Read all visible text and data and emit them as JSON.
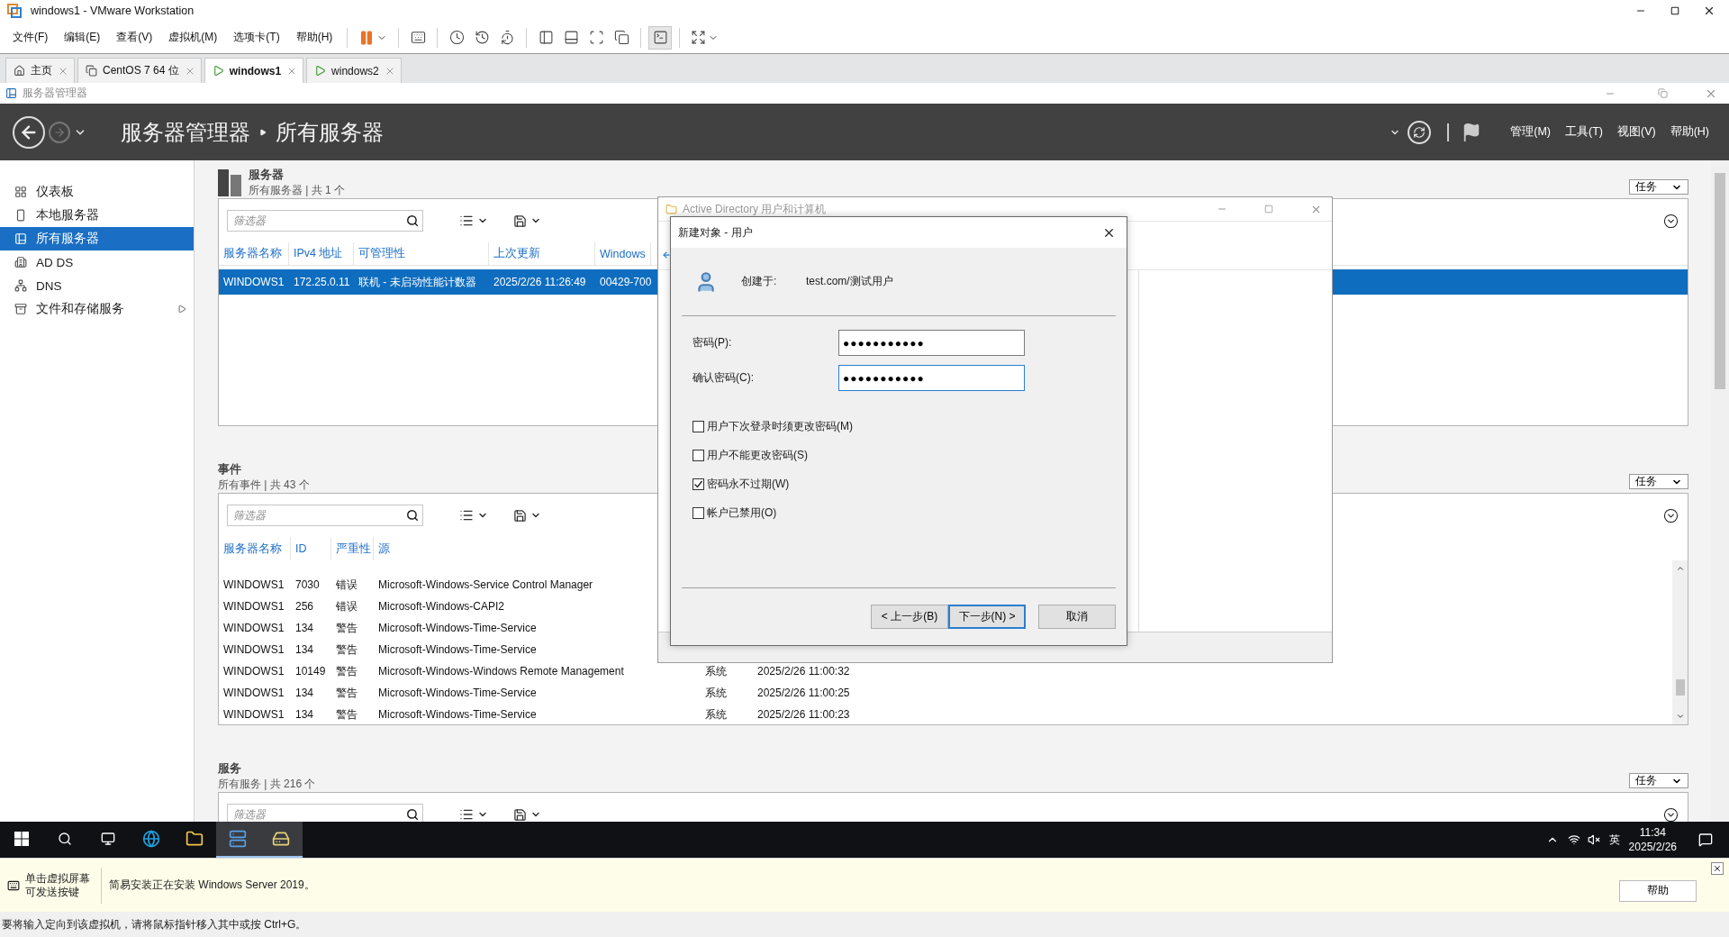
{
  "vmware": {
    "title": "windows1 - VMware Workstation",
    "menu": [
      "文件(F)",
      "编辑(E)",
      "查看(V)",
      "虚拟机(M)",
      "选项卡(T)",
      "帮助(H)"
    ],
    "tabs": [
      {
        "label": "主页",
        "kind": "home",
        "selected": false
      },
      {
        "label": "CentOS 7 64 位",
        "kind": "vm",
        "selected": false
      },
      {
        "label": "windows1",
        "kind": "running",
        "selected": true
      },
      {
        "label": "windows2",
        "kind": "running",
        "selected": false
      }
    ]
  },
  "server_manager": {
    "title": "服务器管理器",
    "breadcrumb": [
      "服务器管理器",
      "所有服务器"
    ],
    "menus": [
      "管理(M)",
      "工具(T)",
      "视图(V)",
      "帮助(H)"
    ],
    "nav": [
      {
        "label": "仪表板",
        "kind": "dashboard",
        "selected": false,
        "expandable": false
      },
      {
        "label": "本地服务器",
        "kind": "local",
        "selected": false,
        "expandable": false
      },
      {
        "label": "所有服务器",
        "kind": "all",
        "selected": true,
        "expandable": false
      },
      {
        "label": "AD DS",
        "kind": "adds",
        "selected": false,
        "expandable": false
      },
      {
        "label": "DNS",
        "kind": "dns",
        "selected": false,
        "expandable": false
      },
      {
        "label": "文件和存储服务",
        "kind": "files",
        "selected": false,
        "expandable": true
      }
    ],
    "sections": [
      {
        "kind": "servers",
        "title": "服务器",
        "subtitle": "所有服务器 | 共 1 个",
        "tasks": "任务",
        "placeholder": "筛选器",
        "columns": [
          "服务器名称",
          "IPv4 地址",
          "可管理性",
          "上次更新",
          "Windows"
        ],
        "rows": [
          {
            "selected": true,
            "cells": [
              "WINDOWS1",
              "172.25.0.11",
              "联机 - 未启动性能计数器",
              "2025/2/26 11:26:49",
              "00429-700"
            ]
          }
        ]
      },
      {
        "kind": "events",
        "title": "事件",
        "subtitle": "所有事件 | 共 43 个",
        "tasks": "任务",
        "placeholder": "筛选器",
        "columns": [
          "服务器名称",
          "ID",
          "严重性",
          "源"
        ],
        "rows": [
          {
            "selected": false,
            "cells": [
              "WINDOWS1",
              "7030",
              "错误",
              "Microsoft-Windows-Service Control Manager"
            ]
          },
          {
            "selected": false,
            "cells": [
              "WINDOWS1",
              "256",
              "错误",
              "Microsoft-Windows-CAPI2"
            ]
          },
          {
            "selected": false,
            "cells": [
              "WINDOWS1",
              "134",
              "警告",
              "Microsoft-Windows-Time-Service"
            ]
          },
          {
            "selected": false,
            "cells": [
              "WINDOWS1",
              "134",
              "警告",
              "Microsoft-Windows-Time-Service"
            ]
          },
          {
            "selected": false,
            "cells": [
              "WINDOWS1",
              "10149",
              "警告",
              "Microsoft-Windows-Windows Remote Management",
              "系统",
              "2025/2/26 11:00:32"
            ]
          },
          {
            "selected": false,
            "cells": [
              "WINDOWS1",
              "134",
              "警告",
              "Microsoft-Windows-Time-Service",
              "系统",
              "2025/2/26 11:00:25"
            ]
          },
          {
            "selected": false,
            "cells": [
              "WINDOWS1",
              "134",
              "警告",
              "Microsoft-Windows-Time-Service",
              "系统",
              "2025/2/26 11:00:23"
            ]
          }
        ]
      },
      {
        "kind": "services",
        "title": "服务",
        "subtitle": "所有服务 | 共 216 个",
        "tasks": "任务",
        "placeholder": "筛选器"
      }
    ]
  },
  "ad_window": {
    "title": "Active Directory 用户和计算机"
  },
  "dialog": {
    "title": "新建对象 - 用户",
    "created_in_label": "创建于:",
    "created_in": "test.com/测试用户",
    "fields": [
      {
        "label": "密码(P):",
        "value": "●●●●●●●●●●●",
        "focused": false
      },
      {
        "label": "确认密码(C):",
        "value": "●●●●●●●●●●●",
        "focused": true
      }
    ],
    "checkboxes": [
      {
        "label": "用户下次登录时须更改密码(M)",
        "checked": false
      },
      {
        "label": "用户不能更改密码(S)",
        "checked": false
      },
      {
        "label": "密码永不过期(W)",
        "checked": true
      },
      {
        "label": "帐户已禁用(O)",
        "checked": false
      }
    ],
    "buttons": [
      {
        "label": "< 上一步(B)",
        "default": false
      },
      {
        "label": "下一步(N) >",
        "default": true
      },
      {
        "label": "取消",
        "default": false
      }
    ]
  },
  "taskbar": {
    "apps": [
      {
        "kind": "browser",
        "active": false
      },
      {
        "kind": "folder",
        "active": false
      },
      {
        "kind": "server",
        "active": true
      },
      {
        "kind": "drive",
        "active": true
      }
    ],
    "ime": "英",
    "time": "11:34",
    "date": "2025/2/26"
  },
  "info_bar": {
    "hint": [
      "单击虚拟屏幕",
      "可发送按键"
    ],
    "message": "简易安装正在安装 Windows Server 2019。",
    "help": "帮助"
  },
  "status_bar": "要将输入定向到该虚拟机，请将鼠标指针移入其中或按 Ctrl+G。"
}
